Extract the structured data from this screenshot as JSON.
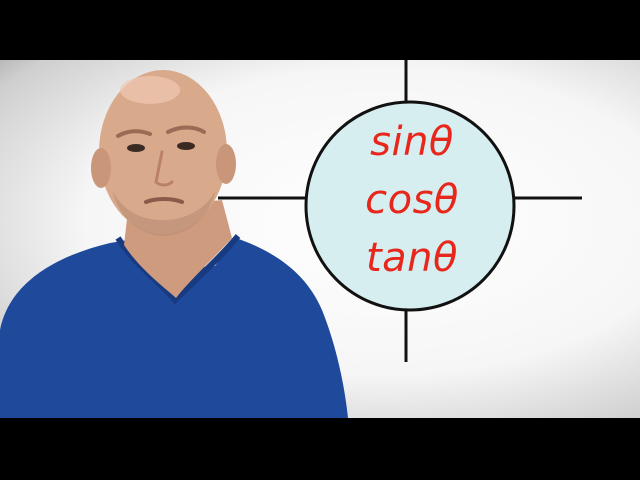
{
  "colors": {
    "letterbox": "#000000",
    "background": "#f6f6f6",
    "circle_fill": "#d7eef0",
    "axis_line": "#111111",
    "formula_text": "#e8271c",
    "sweater": "#1f4a9c",
    "skin": "#d9a98b"
  },
  "diagram": {
    "formulas": [
      "sinθ",
      "cosθ",
      "tanθ"
    ]
  }
}
